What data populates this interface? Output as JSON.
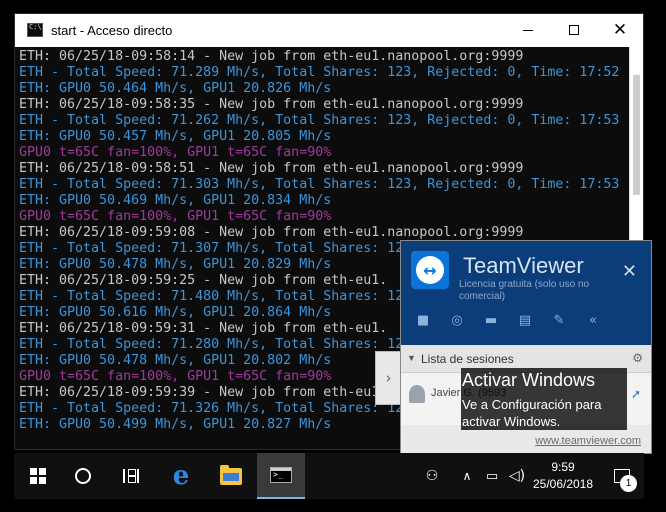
{
  "window": {
    "title": "start - Acceso directo",
    "close_glyph": "✕"
  },
  "console": {
    "lines": [
      {
        "text": "ETH: 06/25/18-09:58:14 - New job from eth-eu1.nanopool.org:9999",
        "color": "white"
      },
      {
        "text": "ETH - Total Speed: 71.289 Mh/s, Total Shares: 123, Rejected: 0, Time: 17:52",
        "color": "cyan"
      },
      {
        "text": "ETH: GPU0 50.464 Mh/s, GPU1 20.826 Mh/s",
        "color": "cyan"
      },
      {
        "text": "ETH: 06/25/18-09:58:35 - New job from eth-eu1.nanopool.org:9999",
        "color": "white"
      },
      {
        "text": "ETH - Total Speed: 71.262 Mh/s, Total Shares: 123, Rejected: 0, Time: 17:53",
        "color": "cyan"
      },
      {
        "text": "ETH: GPU0 50.457 Mh/s, GPU1 20.805 Mh/s",
        "color": "cyan"
      },
      {
        "text": "GPU0 t=65C fan=100%, GPU1 t=65C fan=90%",
        "color": "magenta"
      },
      {
        "text": "ETH: 06/25/18-09:58:51 - New job from eth-eu1.nanopool.org:9999",
        "color": "white"
      },
      {
        "text": "ETH - Total Speed: 71.303 Mh/s, Total Shares: 123, Rejected: 0, Time: 17:53",
        "color": "cyan"
      },
      {
        "text": "ETH: GPU0 50.469 Mh/s, GPU1 20.834 Mh/s",
        "color": "cyan"
      },
      {
        "text": "GPU0 t=65C fan=100%, GPU1 t=65C fan=90%",
        "color": "magenta"
      },
      {
        "text": "ETH: 06/25/18-09:59:08 - New job from eth-eu1.nanopool.org:9999",
        "color": "white"
      },
      {
        "text": "ETH - Total Speed: 71.307 Mh/s, Total Shares: 12",
        "color": "cyan"
      },
      {
        "text": "ETH: GPU0 50.478 Mh/s, GPU1 20.829 Mh/s",
        "color": "cyan"
      },
      {
        "text": "ETH: 06/25/18-09:59:25 - New job from eth-eu1.",
        "color": "white"
      },
      {
        "text": "ETH - Total Speed: 71.480 Mh/s, Total Shares: 12",
        "color": "cyan"
      },
      {
        "text": "ETH: GPU0 50.616 Mh/s, GPU1 20.864 Mh/s",
        "color": "cyan"
      },
      {
        "text": "ETH: 06/25/18-09:59:31 - New job from eth-eu1.",
        "color": "white"
      },
      {
        "text": "ETH - Total Speed: 71.280 Mh/s, Total Shares: 12",
        "color": "cyan"
      },
      {
        "text": "ETH: GPU0 50.478 Mh/s, GPU1 20.802 Mh/s",
        "color": "cyan"
      },
      {
        "text": "GPU0 t=65C fan=100%, GPU1 t=65C fan=90%",
        "color": "magenta"
      },
      {
        "text": "ETH: 06/25/18-09:59:39 - New job from eth-eu1.",
        "color": "white"
      },
      {
        "text": "ETH - Total Speed: 71.326 Mh/s, Total Shares: 12",
        "color": "cyan"
      },
      {
        "text": "ETH: GPU0 50.499 Mh/s, GPU1 20.827 Mh/s",
        "color": "cyan"
      }
    ]
  },
  "teamviewer": {
    "brand": "TeamViewer",
    "license": "Licencia gratuita (solo uso no comercial)",
    "close_glyph": "✕",
    "sessions_label": "Lista de sesiones",
    "session_name": "Javier G. (9593",
    "link": "www.teamviewer.com",
    "handle_glyph": "›",
    "tools": [
      "video-icon",
      "headset-icon",
      "chat-icon",
      "files-icon",
      "whiteboard-icon",
      "collapse-icon"
    ]
  },
  "activation": {
    "title": "Activar Windows",
    "subtitle": "Ve a Configuración para activar Windows."
  },
  "taskbar": {
    "time": "9:59",
    "date": "25/06/2018",
    "notification_count": "1",
    "apps": [
      "start-button",
      "search-button",
      "task-view-button",
      "edge-button",
      "file-explorer-button",
      "cmd-button"
    ]
  },
  "colors": {
    "console_bg": "#0c0c0c",
    "console_white": "#c8c8c8",
    "console_cyan": "#3a96dd",
    "console_magenta": "#a0399e",
    "teamviewer_header": "#0b3d7a",
    "taskbar": "#101010"
  }
}
